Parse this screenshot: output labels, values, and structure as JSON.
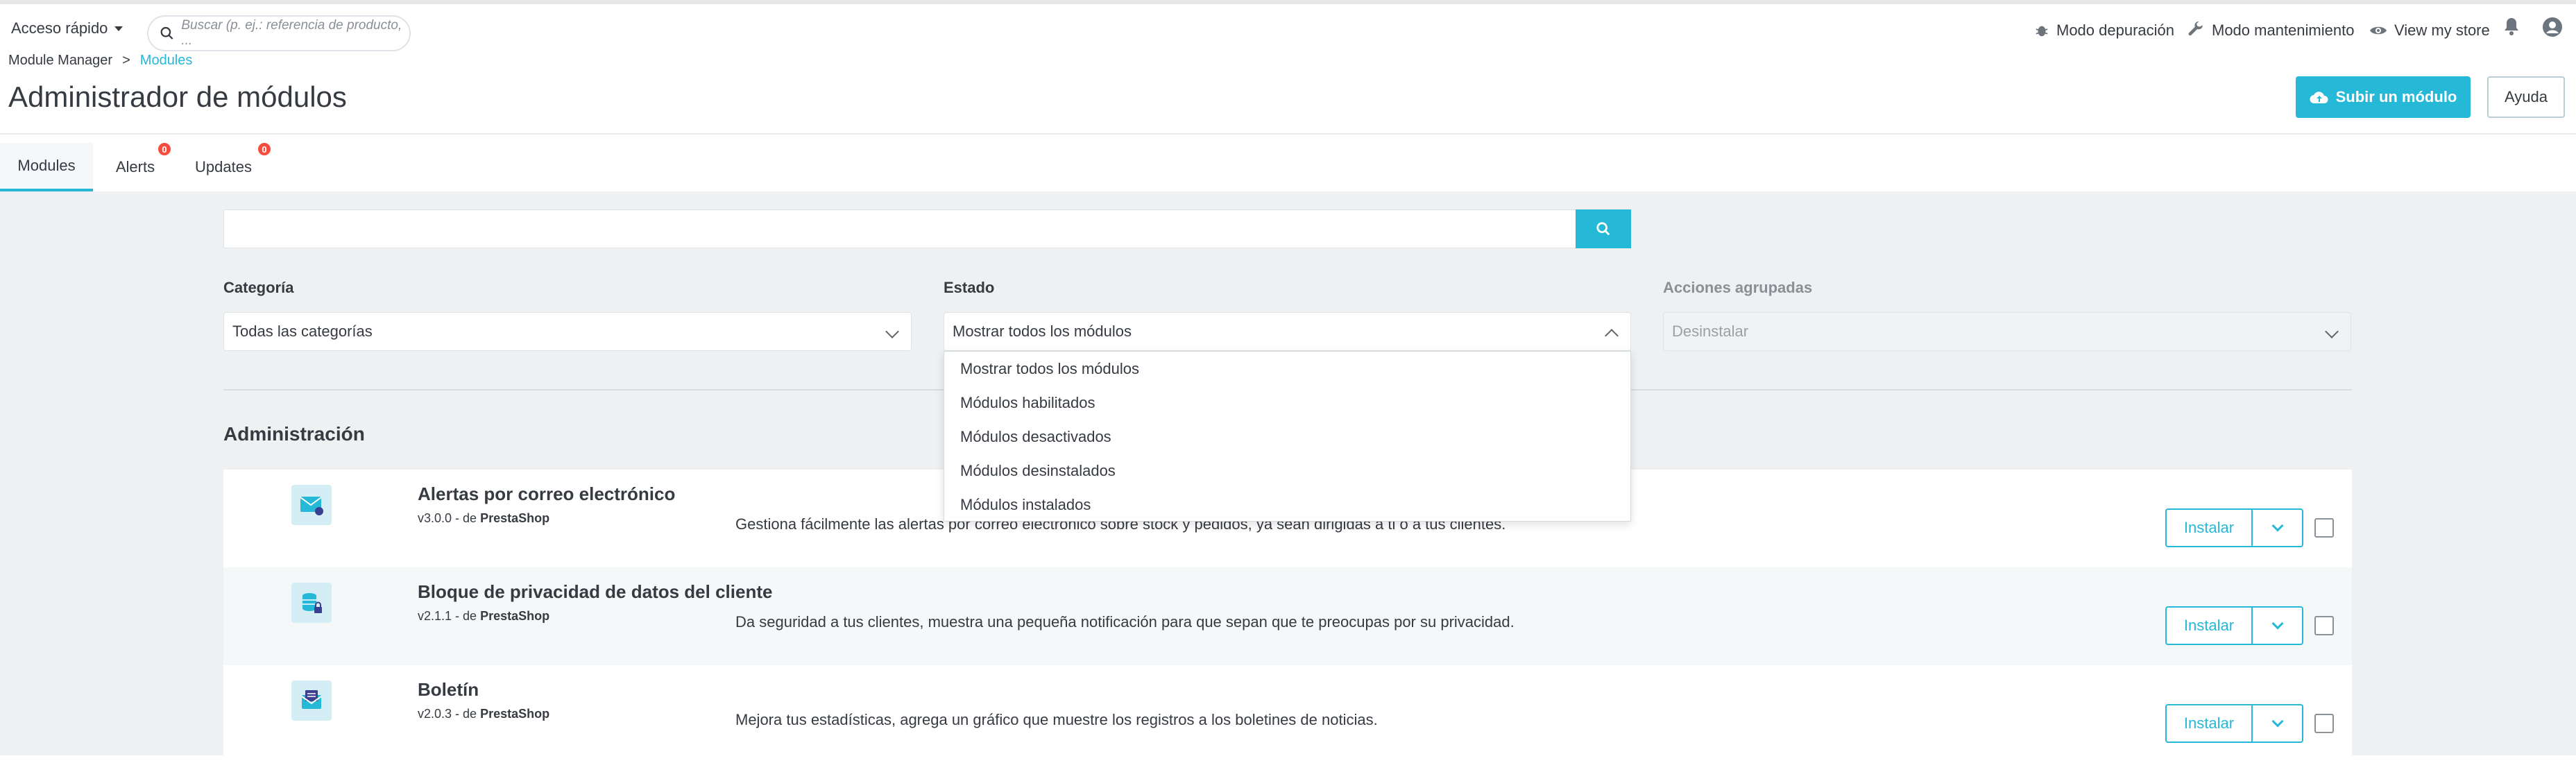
{
  "topbar": {
    "quick_access": "Acceso rápido",
    "search_placeholder": "Buscar (p. ej.: referencia de producto, ...",
    "debug_mode": "Modo depuración",
    "maintenance_mode": "Modo mantenimiento",
    "view_store": "View my store"
  },
  "breadcrumb": {
    "parent": "Module Manager",
    "separator": ">",
    "current": "Modules"
  },
  "header": {
    "title": "Administrador de módulos",
    "upload_button": "Subir un módulo",
    "help_button": "Ayuda"
  },
  "tabs": [
    {
      "label": "Modules"
    },
    {
      "label": "Alerts",
      "badge": "0"
    },
    {
      "label": "Updates",
      "badge": "0"
    }
  ],
  "filters": {
    "category_label": "Categoría",
    "category_value": "Todas las categorías",
    "status_label": "Estado",
    "status_value": "Mostrar todos los módulos",
    "bulk_label": "Acciones agrupadas",
    "bulk_value": "Desinstalar"
  },
  "status_options": [
    "Mostrar todos los módulos",
    "Módulos habilitados",
    "Módulos desactivados",
    "Módulos desinstalados",
    "Módulos instalados"
  ],
  "section_title": "Administración",
  "modules": [
    {
      "name": "Alertas por correo electrónico",
      "version": "v3.0.0 - de",
      "author": "PrestaShop",
      "description": "Gestiona fácilmente las alertas por correo electrónico sobre stock y pedidos, ya sean dirigidas a ti o a tus clientes.",
      "action": "Instalar",
      "icon": "email-alert-icon"
    },
    {
      "name": "Bloque de privacidad de datos del cliente",
      "version": "v2.1.1 - de",
      "author": "PrestaShop",
      "description": "Da seguridad a tus clientes, muestra una pequeña notificación para que sepan que te preocupas por su privacidad.",
      "action": "Instalar",
      "icon": "database-lock-icon"
    },
    {
      "name": "Boletín",
      "version": "v2.0.3 - de",
      "author": "PrestaShop",
      "description": "Mejora tus estadísticas, agrega un gráfico que muestre los registros a los boletines de noticias.",
      "action": "Instalar",
      "icon": "newsletter-icon"
    }
  ],
  "colors": {
    "accent": "#25b9d7",
    "badge": "#f54c3e",
    "text": "#363a41",
    "background": "#eef0f2"
  }
}
